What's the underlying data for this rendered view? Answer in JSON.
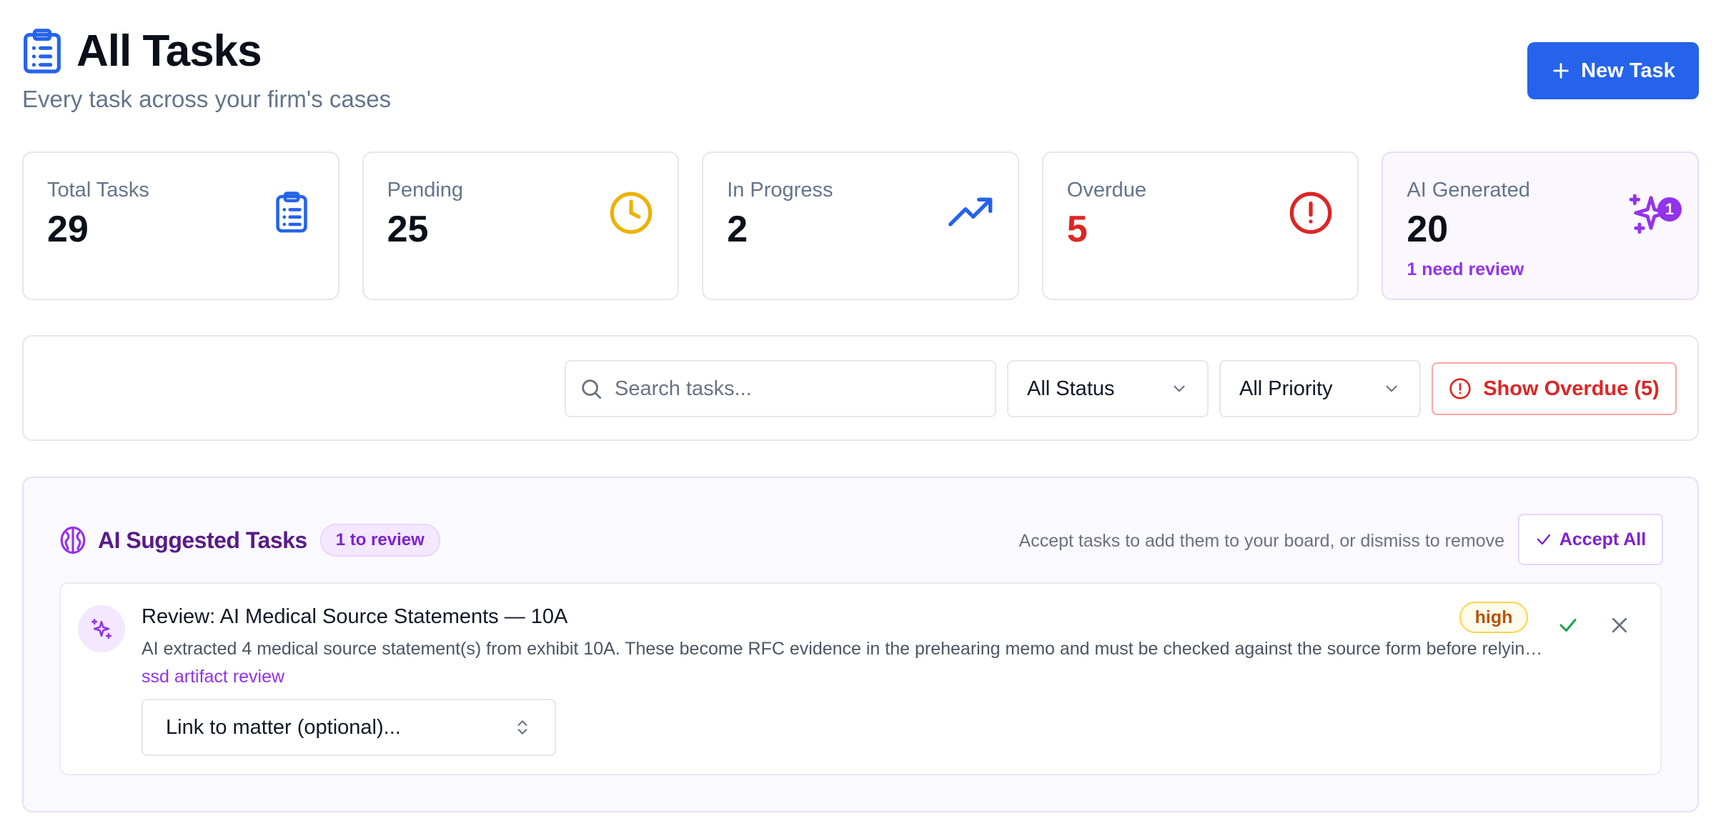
{
  "header": {
    "title": "All Tasks",
    "subtitle": "Every task across your firm's cases",
    "new_task_label": "New Task",
    "icon": "clipboard-icon"
  },
  "stats": [
    {
      "label": "Total Tasks",
      "value": "29",
      "icon": "clipboard-icon",
      "color": "#2563eb"
    },
    {
      "label": "Pending",
      "value": "25",
      "icon": "clock-icon",
      "color": "#eab308"
    },
    {
      "label": "In Progress",
      "value": "2",
      "icon": "trending-up-icon",
      "color": "#2563eb"
    },
    {
      "label": "Overdue",
      "value": "5",
      "icon": "alert-circle-icon",
      "color": "#dc2626"
    },
    {
      "label": "AI Generated",
      "value": "20",
      "sub": "1 need review",
      "badge": "1",
      "icon": "sparkles-icon",
      "color": "#9333ea"
    }
  ],
  "filters": {
    "search_placeholder": "Search tasks...",
    "status_value": "All Status",
    "priority_value": "All Priority",
    "overdue_label": "Show Overdue (5)"
  },
  "ai_panel": {
    "title": "AI Suggested Tasks",
    "review_pill": "1 to review",
    "hint": "Accept tasks to add them to your board, or dismiss to remove",
    "accept_all_label": "Accept All",
    "tasks": [
      {
        "title": "Review: AI Medical Source Statements — 10A",
        "description": "AI extracted 4 medical source statement(s) from exhibit 10A. These become RFC evidence in the prehearing memo and must be checked against the source form before relying on them.",
        "source": "ssd artifact review",
        "priority": "high",
        "matter_placeholder": "Link to matter (optional)..."
      }
    ]
  },
  "colors": {
    "accent": "#2563eb",
    "ai_purple": "#9333ea",
    "danger": "#dc2626",
    "warning": "#eab308"
  }
}
